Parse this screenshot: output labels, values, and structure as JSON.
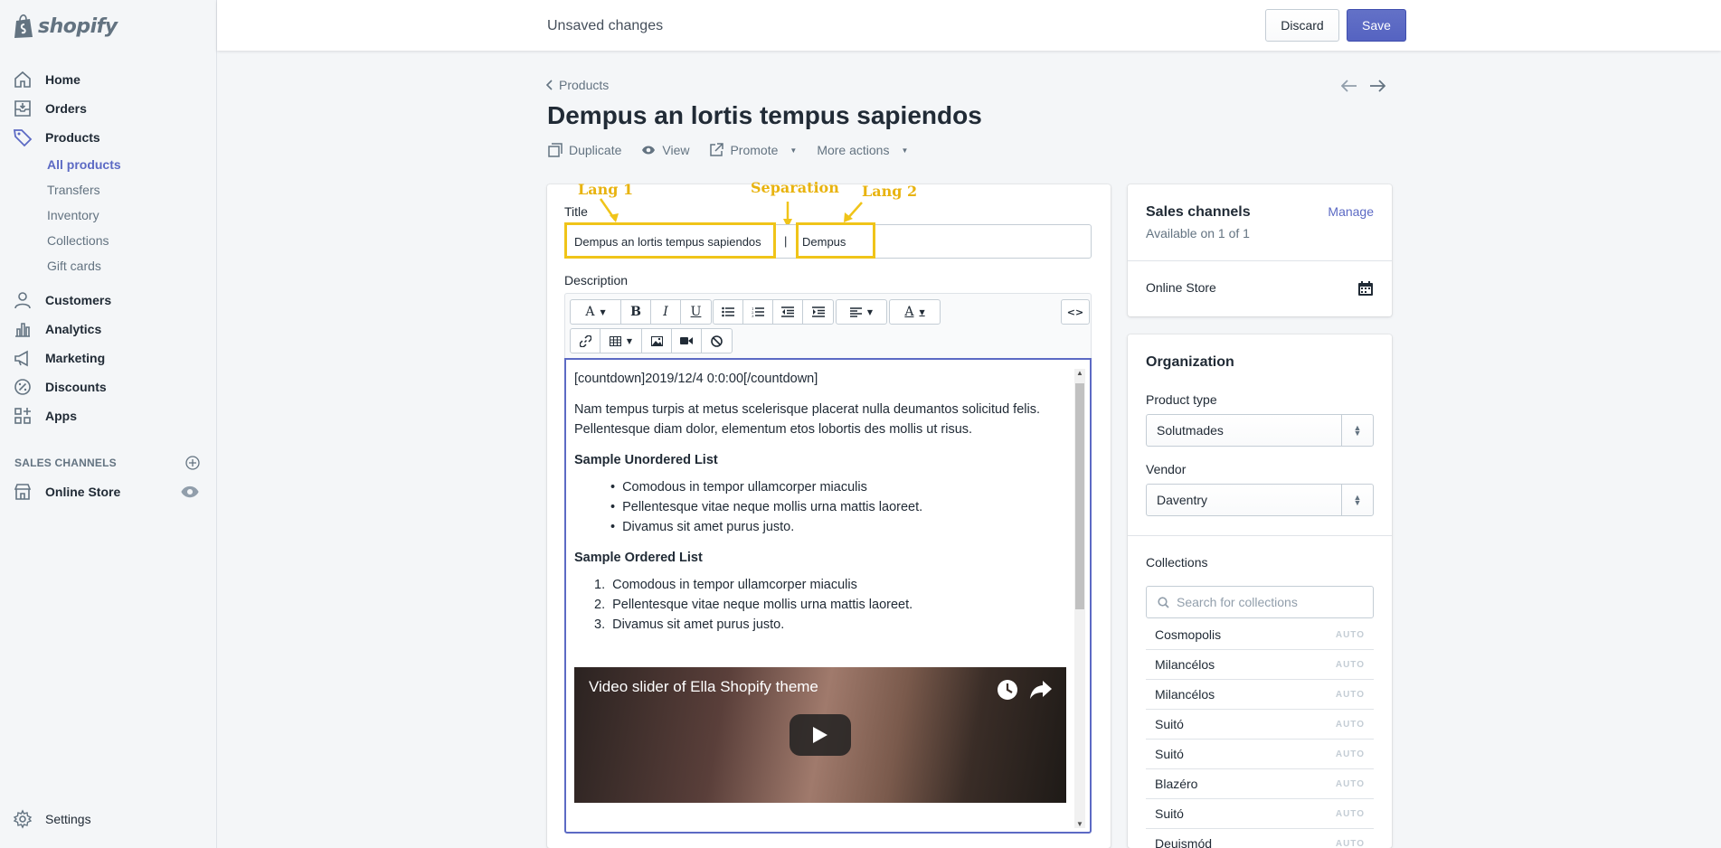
{
  "brand": {
    "name": "shopify"
  },
  "nav": {
    "items": [
      {
        "label": "Home",
        "icon": "home-icon"
      },
      {
        "label": "Orders",
        "icon": "orders-icon"
      },
      {
        "label": "Products",
        "icon": "tag-icon"
      }
    ],
    "products_sub": [
      "All products",
      "Transfers",
      "Inventory",
      "Collections",
      "Gift cards"
    ],
    "items2": [
      {
        "label": "Customers",
        "icon": "customer-icon"
      },
      {
        "label": "Analytics",
        "icon": "analytics-icon"
      },
      {
        "label": "Marketing",
        "icon": "marketing-icon"
      },
      {
        "label": "Discounts",
        "icon": "discount-icon"
      },
      {
        "label": "Apps",
        "icon": "apps-icon"
      }
    ],
    "sales_channels_heading": "SALES CHANNELS",
    "online_store": "Online Store",
    "settings": "Settings"
  },
  "topbar": {
    "status": "Unsaved changes",
    "discard": "Discard",
    "save": "Save"
  },
  "header": {
    "breadcrumb": "Products",
    "title": "Dempus an lortis tempus sapiendos",
    "actions": {
      "duplicate": "Duplicate",
      "view": "View",
      "promote": "Promote",
      "more": "More actions"
    }
  },
  "form": {
    "title_label": "Title",
    "title_lang1": "Dempus an lortis tempus sapiendos",
    "title_separator": "|",
    "title_lang2": "Dempus",
    "annotations": {
      "lang1": "Lang 1",
      "separation": "Separation",
      "lang2": "Lang 2"
    },
    "description_label": "Description",
    "toolbar": {
      "font": "A",
      "bold": "B",
      "italic": "I",
      "underline": "U",
      "color": "A",
      "code": "<>"
    }
  },
  "editor": {
    "countdown": "[countdown]2019/12/4 0:0:00[/countdown]",
    "para1": "Nam tempus turpis at metus scelerisque placerat nulla deumantos solicitud felis. Pellentesque diam dolor, elementum etos lobortis des mollis ut risus.",
    "unordered_heading": "Sample Unordered List",
    "list_items": [
      "Comodous in tempor ullamcorper miaculis",
      "Pellentesque vitae neque mollis urna mattis laoreet.",
      "Divamus sit amet purus justo."
    ],
    "ordered_heading": "Sample Ordered List",
    "ordered_numbers": [
      "1.",
      "2.",
      "3."
    ],
    "video_title": "Video slider of Ella Shopify theme"
  },
  "sales_channels": {
    "title": "Sales channels",
    "manage": "Manage",
    "subtitle": "Available on 1 of 1",
    "online_store": "Online Store"
  },
  "organization": {
    "title": "Organization",
    "product_type_label": "Product type",
    "product_type": "Solutmades",
    "vendor_label": "Vendor",
    "vendor": "Daventry",
    "collections_label": "Collections",
    "search_placeholder": "Search for collections",
    "collections": [
      "Cosmopolis",
      "Milancélos",
      "Milancélos",
      "Suitó",
      "Suitó",
      "Blazéro",
      "Suitó",
      "Deuismód"
    ],
    "auto_badge": "AUTO"
  },
  "colors": {
    "accent": "#5c6ac4",
    "highlight": "#f0c419"
  }
}
